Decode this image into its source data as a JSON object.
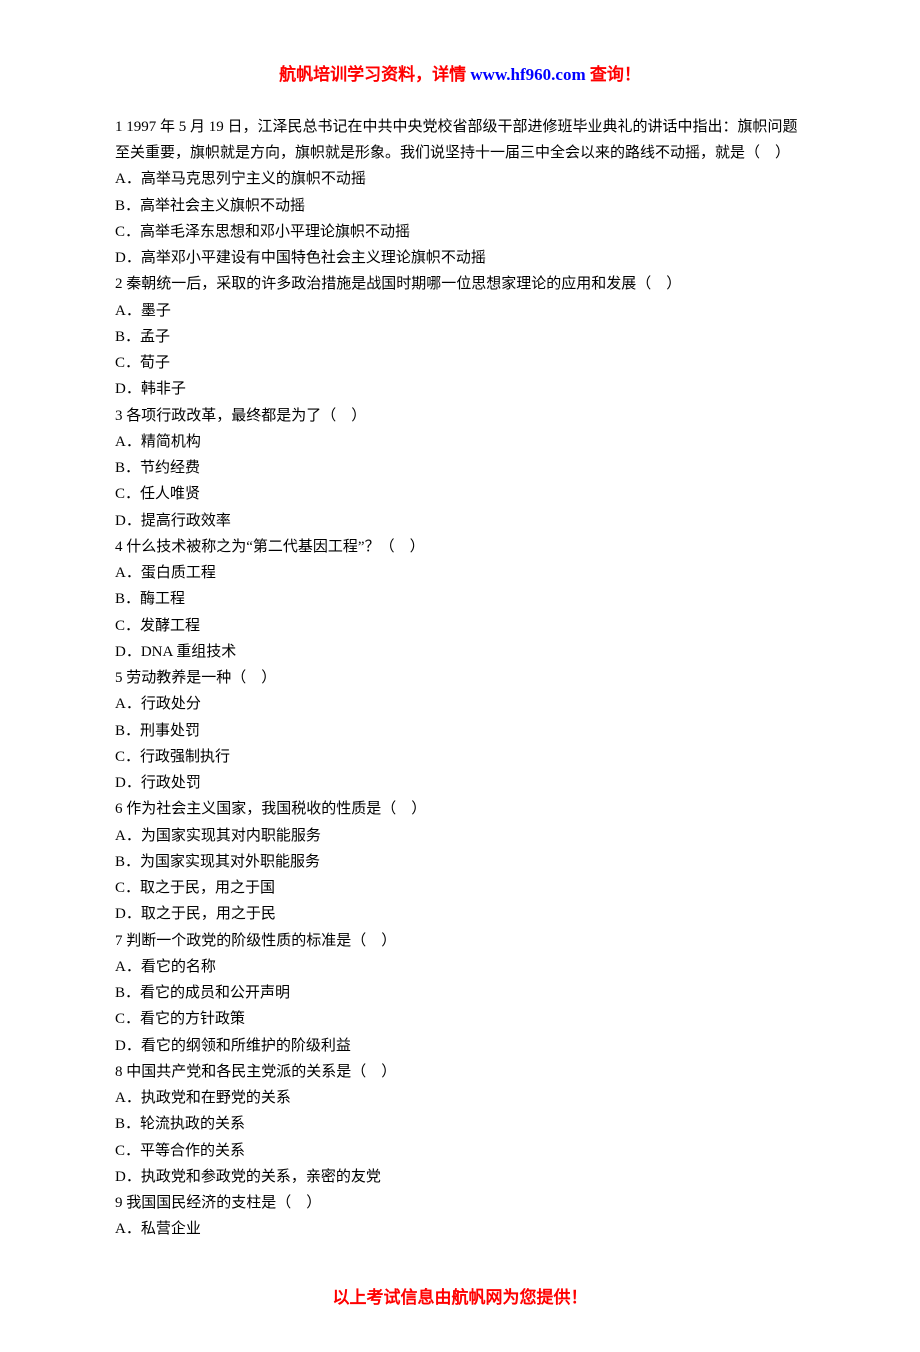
{
  "header": {
    "part1": "航帆培训学习资料，详情 ",
    "url": "www.hf960.com",
    "part2": " 查询！"
  },
  "questions": [
    {
      "stem": "1 1997 年 5 月 19 日，江泽民总书记在中共中央党校省部级干部进修班毕业典礼的讲话中指出：旗帜问题至关重要，旗帜就是方向，旗帜就是形象。我们说坚持十一届三中全会以来的路线不动摇，就是（　）",
      "options": [
        "A．高举马克思列宁主义的旗帜不动摇",
        "B．高举社会主义旗帜不动摇",
        "C．高举毛泽东思想和邓小平理论旗帜不动摇",
        "D．高举邓小平建设有中国特色社会主义理论旗帜不动摇"
      ]
    },
    {
      "stem": "2 秦朝统一后，采取的许多政治措施是战国时期哪一位思想家理论的应用和发展（　）",
      "options": [
        "A．墨子",
        "B．孟子",
        "C．荀子",
        "D．韩非子"
      ]
    },
    {
      "stem": "3 各项行政改革，最终都是为了（　）",
      "options": [
        "A．精简机构",
        "B．节约经费",
        "C．任人唯贤",
        "D．提高行政效率"
      ]
    },
    {
      "stem": "4 什么技术被称之为“第二代基因工程”？（　）",
      "options": [
        "A．蛋白质工程",
        "B．酶工程",
        "C．发酵工程",
        "D．DNA 重组技术"
      ]
    },
    {
      "stem": "5 劳动教养是一种（　）",
      "options": [
        "A．行政处分",
        "B．刑事处罚",
        "C．行政强制执行",
        "D．行政处罚"
      ]
    },
    {
      "stem": "6 作为社会主义国家，我国税收的性质是（　）",
      "options": [
        "A．为国家实现其对内职能服务",
        "B．为国家实现其对外职能服务",
        "C．取之于民，用之于国",
        "D．取之于民，用之于民"
      ]
    },
    {
      "stem": "7 判断一个政党的阶级性质的标准是（　）",
      "options": [
        "A．看它的名称",
        "B．看它的成员和公开声明",
        "C．看它的方针政策",
        "D．看它的纲领和所维护的阶级利益"
      ]
    },
    {
      "stem": "8 中国共产党和各民主党派的关系是（　）",
      "options": [
        "A．执政党和在野党的关系",
        "B．轮流执政的关系",
        "C．平等合作的关系",
        "D．执政党和参政党的关系，亲密的友党"
      ]
    },
    {
      "stem": "9 我国国民经济的支柱是（　）",
      "options": [
        "A．私营企业"
      ]
    }
  ],
  "footer": "以上考试信息由航帆网为您提供！"
}
